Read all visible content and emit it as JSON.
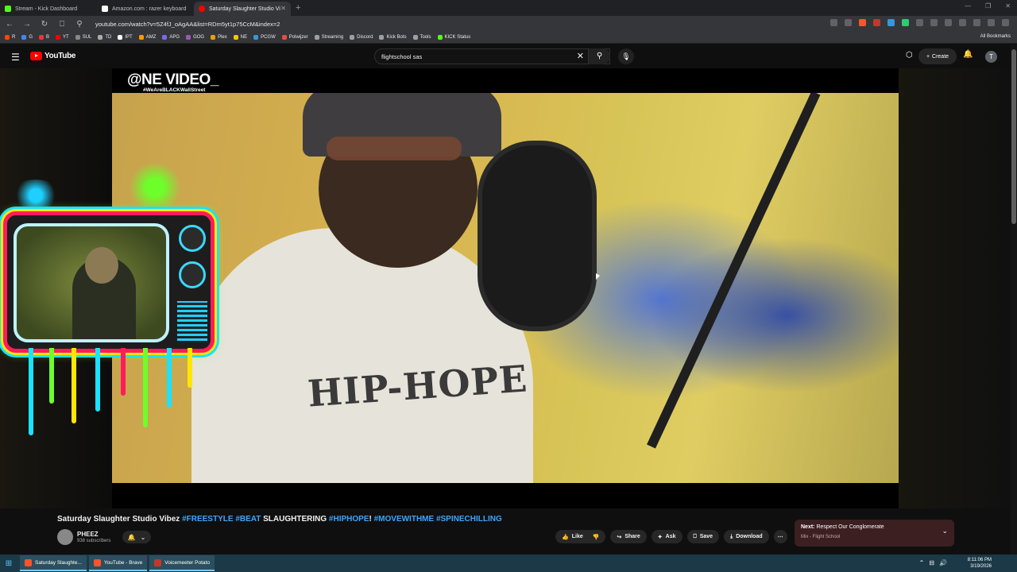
{
  "browser": {
    "tabs": [
      {
        "title": "Stream - Kick Dashboard",
        "color": "#53fc18"
      },
      {
        "title": "Amazon.com : razer keyboard",
        "color": "#ffffff"
      },
      {
        "title": "Saturday Slaughter Studio Vi",
        "color": "#ff0000",
        "active": true
      }
    ],
    "new_tab": "+",
    "url": "youtube.com/watch?v=5Z4fJ_oAgAA&list=RDm5yt1p75CcM&index=2",
    "bookmarks": [
      {
        "label": "R",
        "color": "#ff4500"
      },
      {
        "label": "G",
        "color": "#4285f4"
      },
      {
        "label": "B",
        "color": "#e53935"
      },
      {
        "label": "YT",
        "color": "#ff0000"
      },
      {
        "label": "SUL",
        "color": "#888888"
      },
      {
        "label": "TD",
        "color": "#aaaaaa"
      },
      {
        "label": "IPT",
        "color": "#ffffff"
      },
      {
        "label": "AMZ",
        "color": "#ff9900"
      },
      {
        "label": "APG",
        "color": "#7b68ee"
      },
      {
        "label": "GOG",
        "color": "#9b59b6"
      },
      {
        "label": "Plex",
        "color": "#e5a00d"
      },
      {
        "label": "NE",
        "color": "#f1c40f"
      },
      {
        "label": "PCGW",
        "color": "#3498db"
      },
      {
        "label": "Polwijzer",
        "color": "#e74c3c"
      },
      {
        "label": "Streaming",
        "color": "#9aa0a6"
      },
      {
        "label": "Discord",
        "color": "#9aa0a6"
      },
      {
        "label": "Kick Bots",
        "color": "#9aa0a6"
      },
      {
        "label": "Tools",
        "color": "#9aa0a6"
      },
      {
        "label": "KICK Status",
        "color": "#53fc18"
      }
    ],
    "all_bookmarks": "All Bookmarks"
  },
  "youtube": {
    "logo_text": "YouTube",
    "search_value": "flightschool sas",
    "create_label": "Create",
    "avatar_letter": "T"
  },
  "video": {
    "watermark": "@NE VIDEO_",
    "watermark_sub": "#WeAreBLACKWallStreet",
    "shirt_text": "HIP-HOPE",
    "title_plain_1": "Saturday Slaughter Studio Vibez ",
    "title_tag_1": "#FREESTYLE #BEAT",
    "title_plain_2": " SLAUGHTERING ",
    "title_tag_2": "#HIPHOPE",
    "title_plain_3": "! ",
    "title_tag_3": "#MOVEWITHME #SPINECHILLING",
    "channel": "PHEEZ",
    "subscribers": "938 subscribers",
    "actions": {
      "like": "Like",
      "share": "Share",
      "ask": "Ask",
      "save": "Save",
      "download": "Download"
    }
  },
  "next_up": {
    "label": "Next:",
    "title": "Respect Our Conglomerate",
    "subtitle": "Mix - Flight School"
  },
  "taskbar": {
    "items": [
      {
        "label": "Saturday Slaughte...",
        "color": "#fb542b"
      },
      {
        "label": "YouTube - Brave",
        "color": "#fb542b"
      },
      {
        "label": "Voicemeeter Potato",
        "color": "#c0392b"
      }
    ],
    "time": "8:11:06 PM",
    "date": "3/19/2026"
  }
}
